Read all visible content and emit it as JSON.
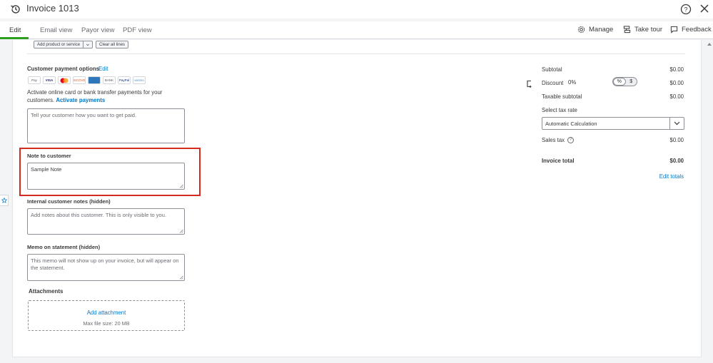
{
  "header": {
    "title": "Invoice 1013"
  },
  "tabs": [
    {
      "label": "Edit"
    },
    {
      "label": "Email view"
    },
    {
      "label": "Payor view"
    },
    {
      "label": "PDF view"
    }
  ],
  "toolbar": {
    "manage": "Manage",
    "tour": "Take tour",
    "feedback": "Feedback"
  },
  "lines": {
    "add_product": "Add product or service",
    "clear_lines": "Clear all lines"
  },
  "payment": {
    "heading": "Customer payment options",
    "edit": "Edit",
    "icons": [
      "Pay",
      "VISA",
      "",
      "DISCOVER",
      "",
      "BANK",
      "PayPal",
      "venmo"
    ],
    "activate_text": "Activate online card or bank transfer payments for your customers.",
    "activate_link": "Activate payments",
    "placeholder": "Tell your customer how you want to get paid."
  },
  "note": {
    "label": "Note to customer",
    "value": "Sample Note"
  },
  "internal": {
    "label": "Internal customer notes (hidden)",
    "placeholder": "Add notes about this customer. This is only visible to you."
  },
  "memo": {
    "label": "Memo on statement (hidden)",
    "placeholder": "This memo will not show up on your invoice, but will appear on the statement."
  },
  "attachments": {
    "label": "Attachments",
    "link": "Add attachment",
    "max_size": "Max file size: 20 MB"
  },
  "totals": {
    "subtotal_label": "Subtotal",
    "subtotal": "$0.00",
    "discount_label": "Discount",
    "discount_pct": "0%",
    "discount": "$0.00",
    "toggle_pct": "%",
    "toggle_dollar": "$",
    "taxable_label": "Taxable subtotal",
    "taxable": "$0.00",
    "tax_rate_label": "Select tax rate",
    "tax_rate_value": "Automatic Calculation",
    "sales_tax_label": "Sales tax",
    "sales_tax": "$0.00",
    "invoice_total_label": "Invoice total",
    "invoice_total": "$0.00",
    "edit_totals": "Edit totals"
  },
  "colors": {
    "accent_green": "#2ca01c",
    "link_blue": "#0077c5",
    "highlight_red": "#d52b1e"
  }
}
